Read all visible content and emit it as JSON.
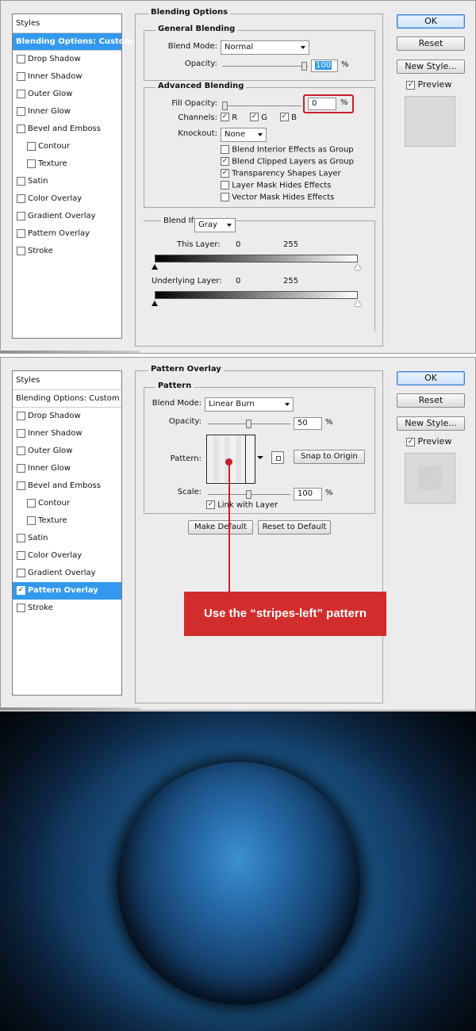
{
  "panel1": {
    "styles_header": "Styles",
    "styles": [
      {
        "label": "Blending Options: Custom",
        "checkable": false,
        "checked": false,
        "selected": true,
        "sub": false
      },
      {
        "label": "Drop Shadow",
        "checkable": true,
        "checked": false,
        "selected": false,
        "sub": false
      },
      {
        "label": "Inner Shadow",
        "checkable": true,
        "checked": false,
        "selected": false,
        "sub": false
      },
      {
        "label": "Outer Glow",
        "checkable": true,
        "checked": false,
        "selected": false,
        "sub": false
      },
      {
        "label": "Inner Glow",
        "checkable": true,
        "checked": false,
        "selected": false,
        "sub": false
      },
      {
        "label": "Bevel and Emboss",
        "checkable": true,
        "checked": false,
        "selected": false,
        "sub": false
      },
      {
        "label": "Contour",
        "checkable": true,
        "checked": false,
        "selected": false,
        "sub": true
      },
      {
        "label": "Texture",
        "checkable": true,
        "checked": false,
        "selected": false,
        "sub": true
      },
      {
        "label": "Satin",
        "checkable": true,
        "checked": false,
        "selected": false,
        "sub": false
      },
      {
        "label": "Color Overlay",
        "checkable": true,
        "checked": false,
        "selected": false,
        "sub": false
      },
      {
        "label": "Gradient Overlay",
        "checkable": true,
        "checked": false,
        "selected": false,
        "sub": false
      },
      {
        "label": "Pattern Overlay",
        "checkable": true,
        "checked": false,
        "selected": false,
        "sub": false
      },
      {
        "label": "Stroke",
        "checkable": true,
        "checked": false,
        "selected": false,
        "sub": false
      }
    ],
    "section_title": "Blending Options",
    "general": {
      "title": "General Blending",
      "blend_mode_label": "Blend Mode:",
      "blend_mode": "Normal",
      "opacity_label": "Opacity:",
      "opacity": "100",
      "percent": "%",
      "opacity_level": 1.0
    },
    "advanced": {
      "title": "Advanced Blending",
      "fill_opacity_label": "Fill Opacity:",
      "fill_opacity": "0",
      "percent": "%",
      "fill_opacity_level": 0.0,
      "channels_label": "Channels:",
      "channels": [
        {
          "label": "R",
          "checked": true
        },
        {
          "label": "G",
          "checked": true
        },
        {
          "label": "B",
          "checked": true
        }
      ],
      "knockout_label": "Knockout:",
      "knockout": "None",
      "options": [
        {
          "label": "Blend Interior Effects as Group",
          "checked": false
        },
        {
          "label": "Blend Clipped Layers as Group",
          "checked": true
        },
        {
          "label": "Transparency Shapes Layer",
          "checked": true
        },
        {
          "label": "Layer Mask Hides Effects",
          "checked": false
        },
        {
          "label": "Vector Mask Hides Effects",
          "checked": false
        }
      ]
    },
    "blend_if": {
      "label": "Blend If:",
      "value": "Gray",
      "this_layer_label": "This Layer:",
      "this_layer_low": "0",
      "this_layer_high": "255",
      "underlying_label": "Underlying Layer:",
      "underlying_low": "0",
      "underlying_high": "255"
    },
    "buttons": {
      "ok": "OK",
      "reset": "Reset",
      "new_style": "New Style...",
      "preview": "Preview"
    },
    "preview_checked": true
  },
  "panel2": {
    "styles_header": "Styles",
    "styles": [
      {
        "label": "Blending Options: Custom",
        "checkable": false,
        "checked": false,
        "selected": false,
        "sub": false
      },
      {
        "label": "Drop Shadow",
        "checkable": true,
        "checked": false,
        "selected": false,
        "sub": false
      },
      {
        "label": "Inner Shadow",
        "checkable": true,
        "checked": false,
        "selected": false,
        "sub": false
      },
      {
        "label": "Outer Glow",
        "checkable": true,
        "checked": false,
        "selected": false,
        "sub": false
      },
      {
        "label": "Inner Glow",
        "checkable": true,
        "checked": false,
        "selected": false,
        "sub": false
      },
      {
        "label": "Bevel and Emboss",
        "checkable": true,
        "checked": false,
        "selected": false,
        "sub": false
      },
      {
        "label": "Contour",
        "checkable": true,
        "checked": false,
        "selected": false,
        "sub": true
      },
      {
        "label": "Texture",
        "checkable": true,
        "checked": false,
        "selected": false,
        "sub": true
      },
      {
        "label": "Satin",
        "checkable": true,
        "checked": false,
        "selected": false,
        "sub": false
      },
      {
        "label": "Color Overlay",
        "checkable": true,
        "checked": false,
        "selected": false,
        "sub": false
      },
      {
        "label": "Gradient Overlay",
        "checkable": true,
        "checked": false,
        "selected": false,
        "sub": false
      },
      {
        "label": "Pattern Overlay",
        "checkable": true,
        "checked": true,
        "selected": true,
        "sub": false
      },
      {
        "label": "Stroke",
        "checkable": true,
        "checked": false,
        "selected": false,
        "sub": false
      }
    ],
    "section_title": "Pattern Overlay",
    "pattern": {
      "title": "Pattern",
      "blend_mode_label": "Blend Mode:",
      "blend_mode": "Linear Burn",
      "opacity_label": "Opacity:",
      "opacity": "50",
      "opacity_level": 0.5,
      "pattern_label": "Pattern:",
      "snap_button": "Snap to Origin",
      "scale_label": "Scale:",
      "scale": "100",
      "scale_level": 0.5,
      "percent": "%",
      "link_label": "Link with Layer",
      "link_checked": true
    },
    "make_default": "Make Default",
    "reset_default": "Reset to Default",
    "buttons": {
      "ok": "OK",
      "reset": "Reset",
      "new_style": "New Style...",
      "preview": "Preview"
    },
    "preview_checked": true
  },
  "callout_text": "Use the “stripes-left” pattern",
  "colors": {
    "selection": "#3399ee",
    "callout": "#d22d2d",
    "highlight_box": "#cc1f2b",
    "art_glow": "#3a8ed0"
  }
}
